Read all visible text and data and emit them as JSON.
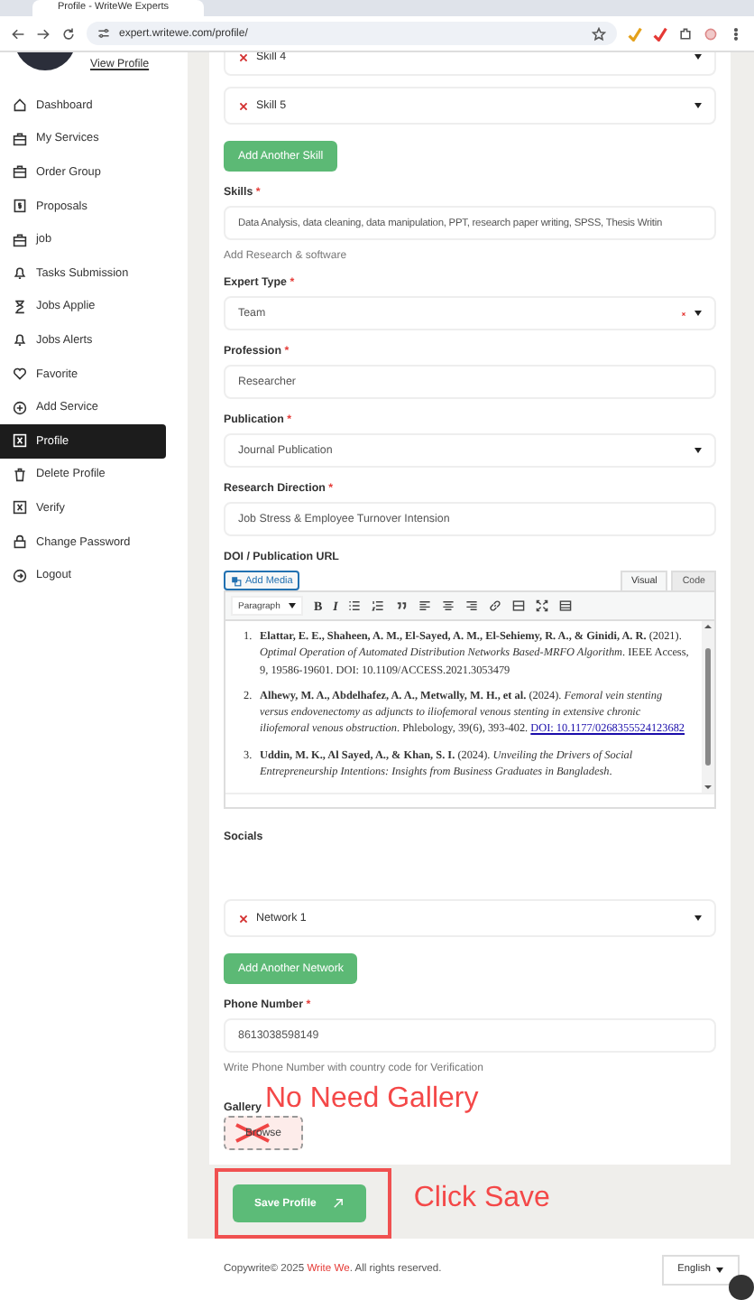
{
  "browser": {
    "tab_title": "Profile - WriteWe Experts",
    "url": "expert.writewe.com/profile/"
  },
  "sidebar": {
    "profile_link": "View Profile",
    "items": [
      {
        "label": "Dashboard",
        "selected": false
      },
      {
        "label": "My Services",
        "selected": false
      },
      {
        "label": "Order Group",
        "selected": false
      },
      {
        "label": "Proposals",
        "selected": false
      },
      {
        "label": "job",
        "selected": false
      },
      {
        "label": "Tasks Submission",
        "selected": false
      },
      {
        "label": "Jobs Applie",
        "selected": false
      },
      {
        "label": "Jobs Alerts",
        "selected": false
      },
      {
        "label": "Favorite",
        "selected": false
      },
      {
        "label": "Add Service",
        "selected": false
      },
      {
        "label": "Profile",
        "selected": true
      },
      {
        "label": "Delete Profile",
        "selected": false
      },
      {
        "label": "Verify",
        "selected": false
      },
      {
        "label": "Change Password",
        "selected": false
      },
      {
        "label": "Logout",
        "selected": false
      }
    ]
  },
  "form": [
    {
      "kind": "removable-select",
      "value": "Skill 4"
    },
    {
      "kind": "removable-select",
      "value": "Skill 5"
    },
    {
      "kind": "add-button",
      "label": "Add Another Skill"
    },
    {
      "kind": "input",
      "label": "Skills",
      "required_mark": "*",
      "value": "Data Analysis, data cleaning, data manipulation, PPT, research paper writing, SPSS, Thesis Writin"
    },
    {
      "kind": "hint",
      "text": "Add Research & software"
    },
    {
      "kind": "select",
      "label": "Expert Type",
      "required_mark": "*",
      "value": "Team",
      "clearable": true
    },
    {
      "kind": "input",
      "label": "Profession",
      "required_mark": "*",
      "value": "Researcher"
    },
    {
      "kind": "select",
      "label": "Publication",
      "required_mark": "*",
      "value": "Journal Publication",
      "clearable": false
    },
    {
      "kind": "input",
      "label": "Research Direction",
      "required_mark": "*",
      "value": "Job Stress & Employee Turnover Intension"
    },
    {
      "kind": "editor",
      "label": "DOI / Publication URL",
      "media_button": "Add Media",
      "tabs": [
        {
          "label": "Visual",
          "selected": true
        },
        {
          "label": "Code",
          "selected": false
        }
      ],
      "format": "Paragraph",
      "toolbar": [
        {
          "kind": "bold",
          "label": "B"
        },
        {
          "kind": "italic",
          "label": "I"
        },
        {
          "kind": "bullet-list"
        },
        {
          "kind": "number-list"
        },
        {
          "kind": "quote"
        },
        {
          "kind": "align-left"
        },
        {
          "kind": "align-center"
        },
        {
          "kind": "align-right"
        },
        {
          "kind": "link"
        },
        {
          "kind": "rule"
        },
        {
          "kind": "fullscreen"
        },
        {
          "kind": "toolbar-toggle"
        }
      ],
      "references": [
        {
          "number": "1.",
          "text": "**Elattar, E. E., Shaheen, A. M., El-Sayed, A. M., El-Sehiemy, R. A., & Ginidi, A. R.** (2021). *Optimal Operation of Automated Distribution Networks Based-MRFO Algorithm*. IEEE Access, 9, 19586-19601. DOI: 10.1109/ACCESS.2021.3053479"
        },
        {
          "number": "2.",
          "text": "**Alhewy, M. A., Abdelhafez, A. A., Metwally, M. H., et al.** (2024). *Femoral vein stenting versus endovenectomy as adjuncts to iliofemoral venous stenting in extensive chronic iliofemoral venous obstruction*. Phlebology, 39(6), 393-402.",
          "link": "DOI: 10.1177/0268355524123682"
        },
        {
          "number": "3.",
          "text": "**Uddin, M. K., Al Sayed, A., & Khan, S. I.** (2024). *Unveiling the Drivers of Social Entrepreneurship Intentions: Insights from Business Graduates in Bangladesh*."
        }
      ]
    },
    {
      "kind": "section-label",
      "text": "Socials"
    },
    {
      "kind": "removable-select",
      "value": "Network 1"
    },
    {
      "kind": "add-button",
      "label": "Add Another Network"
    },
    {
      "kind": "input",
      "label": "Phone Number",
      "required_mark": "*",
      "value": "8613038598149"
    },
    {
      "kind": "hint",
      "text": "Write Phone Number with country code for Verification"
    },
    {
      "kind": "gallery",
      "label": "Gallery",
      "button": "Browse",
      "note": "No Need Gallery",
      "crossed": true
    }
  ],
  "save": {
    "label": "Save Profile",
    "highlighted": true,
    "note": "Click Save"
  },
  "footer": {
    "copyright": "Copywrite© 2025",
    "brand": "Write We",
    "rest": ". All rights reserved.",
    "language": "English"
  }
}
